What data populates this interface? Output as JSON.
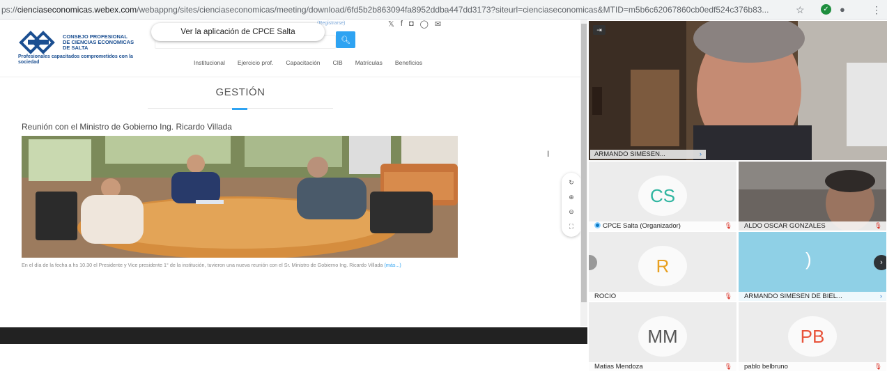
{
  "browser": {
    "url_prefix": "ps://",
    "url_host": "cienciaseconomicas.webex.com",
    "url_path": "/webappng/sites/cienciaseconomicas/meeting/download/6fd5b2b863094fa8952ddba447dd3173?siteurl=cienciaseconomicas&MTID=m5b6c62067860cb0edf524c376b83..."
  },
  "site": {
    "logo_line1": "CONSEJO PROFESIONAL",
    "logo_line2": "DE CIENCIAS ECONOMICAS",
    "logo_line3": "DE SALTA",
    "logo_tagline": "Profesionales capacitados comprometidos con la sociedad",
    "app_banner": "Ver la aplicación de CPCE Salta",
    "register_link": "(Registrarse)",
    "nav": [
      "Institucional",
      "Ejercicio prof.",
      "Capacitación",
      "CIB",
      "Matrículas",
      "Beneficios"
    ],
    "section_title": "GESTIÓN",
    "article_title": "Reunión con el Ministro de Gobierno Ing. Ricardo Villada",
    "caption_text": "En el día de la fecha a hs 10.30  el Presidente y Vice presidente 1° de la institución, tuvieron una nueva reunión con el Sr. Ministro de Gobierno Ing. Ricardo Villada",
    "more_link": "(más...)"
  },
  "meeting": {
    "main_speaker": "ARMANDO SIMESEN...",
    "participants": [
      {
        "initials": "CS",
        "name": "CPCE Salta (Organizador)",
        "initials_color": "#2fb5a0"
      },
      {
        "initials": "",
        "name": "ALDO OSCAR GONZALES",
        "initials_color": ""
      },
      {
        "initials": "R",
        "name": "ROCIO",
        "initials_color": "#e8a020"
      },
      {
        "initials": "",
        "name": "ARMANDO SIMESEN DE BIEL...",
        "initials_color": ""
      },
      {
        "initials": "MM",
        "name": "Matias Mendoza",
        "initials_color": "#555555"
      },
      {
        "initials": "PB",
        "name": "pablo belbruno",
        "initials_color": "#e8533a"
      }
    ]
  }
}
